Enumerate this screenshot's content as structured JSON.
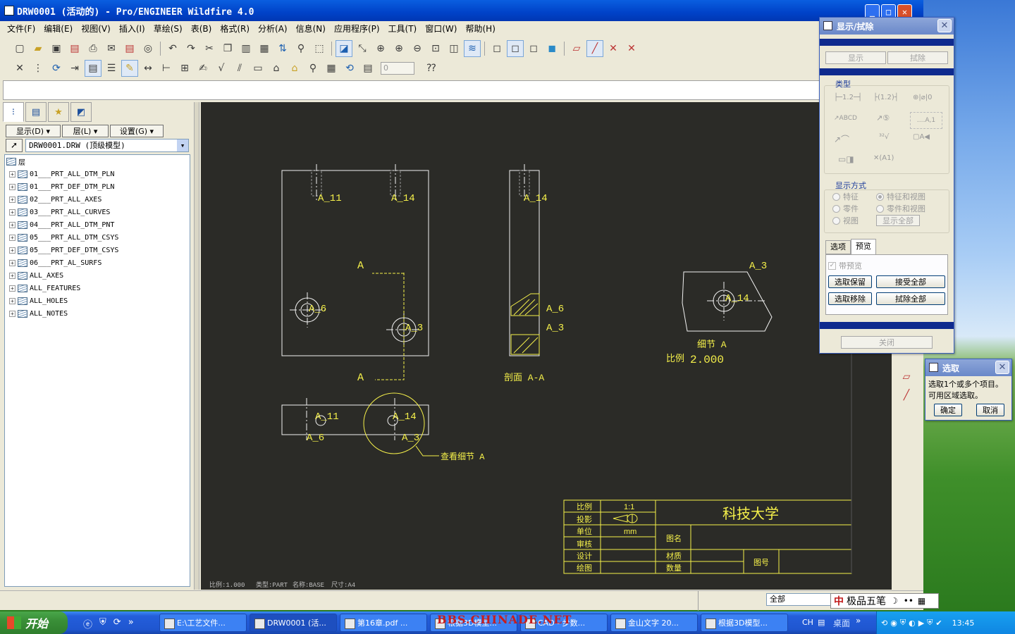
{
  "window": {
    "title": "DRW0001 (活动的) - Pro/ENGINEER Wildfire 4.0",
    "menus": [
      "文件(F)",
      "编辑(E)",
      "视图(V)",
      "插入(I)",
      "草绘(S)",
      "表(B)",
      "格式(R)",
      "分析(A)",
      "信息(N)",
      "应用程序(P)",
      "工具(T)",
      "窗口(W)",
      "帮助(H)"
    ]
  },
  "toolbar": {
    "spin_value": "0"
  },
  "left_panel": {
    "show_btn": "显示(D)",
    "layer_btn": "层(L)",
    "settings_btn": "设置(G)",
    "model_combo": "DRW0001.DRW (顶级模型)",
    "root": "层",
    "layers": [
      "01___PRT_ALL_DTM_PLN",
      "01___PRT_DEF_DTM_PLN",
      "02___PRT_ALL_AXES",
      "03___PRT_ALL_CURVES",
      "04___PRT_ALL_DTM_PNT",
      "05___PRT_ALL_DTM_CSYS",
      "05___PRT_DEF_DTM_CSYS",
      "06___PRT_AL_SURFS",
      "ALL_AXES",
      "ALL_FEATURES",
      "ALL_HOLES",
      "ALL_NOTES"
    ]
  },
  "drawing": {
    "labels": {
      "a11_top": "A_11",
      "a14_top": "A_14",
      "a14_side": "A_14",
      "a_arrow_top": "A",
      "a_arrow_bottom": "A",
      "a6_front": "A_6",
      "a3_front": "A_3",
      "a6_section": "A_6",
      "a3_section": "A_3",
      "section_title": "剖面 A-A",
      "a3_detail": "A_3",
      "a14_detail": "A_14",
      "detail_title": "细节 A",
      "detail_scale_label": "比例",
      "detail_scale_value": "2.000",
      "a11_bottom": "A_11",
      "a14_bottom": "A_14",
      "a6_bottom": "A_6",
      "a3_bottom": "A_3",
      "see_detail": "查看细节 A"
    },
    "title_block": {
      "scale_label": "比例",
      "scale_value": "1:1",
      "projection_label": "投影",
      "unit_label": "单位",
      "unit_value": "mm",
      "review_label": "审核",
      "design_label": "设计",
      "draw_label": "绘图",
      "school": "科技大学",
      "drawing_name_label": "图名",
      "material_label": "材质",
      "quantity_label": "数量",
      "drawing_no_label": "图号"
    },
    "footer": {
      "scale": "比例:1.000",
      "type": "类型:PART",
      "name": "名称:BASE",
      "size": "尺寸:A4"
    },
    "colors": {
      "background": "#2b2b27",
      "lines": "#f2f2f2",
      "annotations": "#f5f04a",
      "hidden": "#9a9a9a"
    }
  },
  "display_dialog": {
    "title": "显示/拭除",
    "show_btn": "显示",
    "erase_btn": "拭除",
    "type_label": "类型",
    "display_mode_label": "显示方式",
    "opt_feature": "特征",
    "opt_feature_view": "特征和视图",
    "opt_part": "零件",
    "opt_part_view": "零件和视图",
    "opt_view": "视图",
    "show_all_btn": "显示全部",
    "tab_options": "选项",
    "tab_preview": "预览",
    "with_preview": "带预览",
    "select_keep": "选取保留",
    "accept_all": "接受全部",
    "select_remove": "选取移除",
    "erase_all": "拭除全部",
    "close_btn": "关闭"
  },
  "select_dialog": {
    "title": "选取",
    "line1": "选取1个或多个项目。",
    "line2": "可用区域选取。",
    "ok": "确定",
    "cancel": "取消"
  },
  "status": {
    "filter": "全部"
  },
  "ime": {
    "label": "极品五笔"
  },
  "taskbar": {
    "start": "开始",
    "tasks": [
      "E:\\工艺文件...",
      "DRW0001 (活...",
      "第16章.pdf ...",
      "根据3D模型...",
      "CAD - 步数...",
      "金山文字 20...",
      "根据3D模型..."
    ],
    "lang": "CH",
    "desktop": "桌面",
    "clock": "13:45"
  },
  "watermark": "BBS.CHINADE.NET"
}
